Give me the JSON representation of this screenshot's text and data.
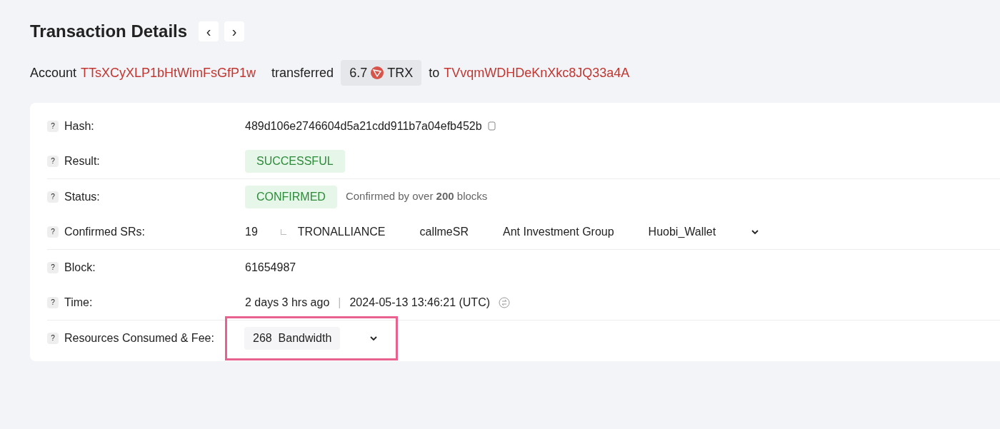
{
  "header": {
    "title": "Transaction Details",
    "prev": "‹",
    "next": "›"
  },
  "summary": {
    "prefix": "Account",
    "from": "TTsXCyXLP1bHtWimFsGfP1w",
    "verb": "transferred",
    "amount": "6.7",
    "token": "TRX",
    "to_word": "to",
    "to": "TVvqmWDHDeKnXkc8JQ33a4A"
  },
  "sections": [
    {
      "rows": [
        {
          "kind": "hash",
          "label": "Hash:",
          "value": "489d106e2746604d5a21cdd911b7a04efb452b"
        },
        {
          "kind": "badge",
          "label": "Result:",
          "value": "SUCCESSFUL"
        }
      ]
    },
    {
      "rows": [
        {
          "kind": "badge",
          "label": "Status:",
          "value": "CONFIRMED",
          "note": "Confirmed by over **200** blocks"
        },
        {
          "kind": "list",
          "label": "Confirmed SRs:",
          "count": "19",
          "items": [
            "TRONALLIANCE",
            "callmeSR",
            "Ant Investment Group",
            "Huobi_Wallet"
          ]
        }
      ]
    },
    {
      "rows": [
        {
          "kind": "text",
          "label": "Block:",
          "value": "61654987"
        },
        {
          "kind": "time",
          "label": "Time:",
          "ago": "2 days 3 hrs ago",
          "sep": "|",
          "value": "2024-05-13 13:46:21 (UTC)"
        }
      ]
    },
    {
      "rows": [
        {
          "kind": "resource",
          "label": "Resources Consumed & Fee:",
          "amount": "268",
          "unit": "Bandwidth",
          "highlighted": true
        }
      ]
    }
  ],
  "help_mark": "?"
}
